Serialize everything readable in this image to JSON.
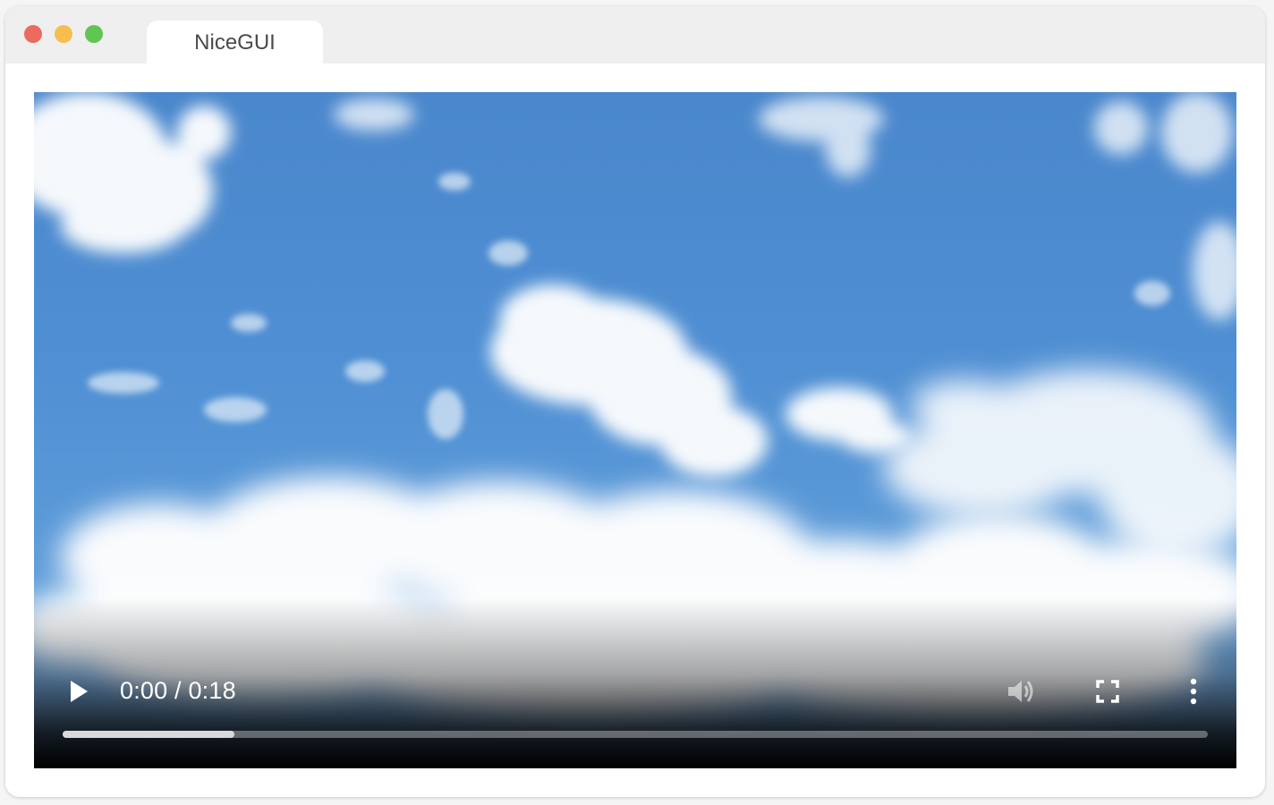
{
  "window": {
    "tab_title": "NiceGUI",
    "traffic_lights": {
      "close": "#ec6a5e",
      "minimize": "#f4bf4f",
      "zoom": "#61c554"
    }
  },
  "video": {
    "current_time": "0:00",
    "duration": "0:18",
    "time_label": "0:00 / 0:18",
    "buffered_fraction": 0.15,
    "icons": {
      "play": "play-icon",
      "mute": "volume-icon",
      "fullscreen": "fullscreen-icon",
      "more": "more-vertical-icon"
    }
  }
}
